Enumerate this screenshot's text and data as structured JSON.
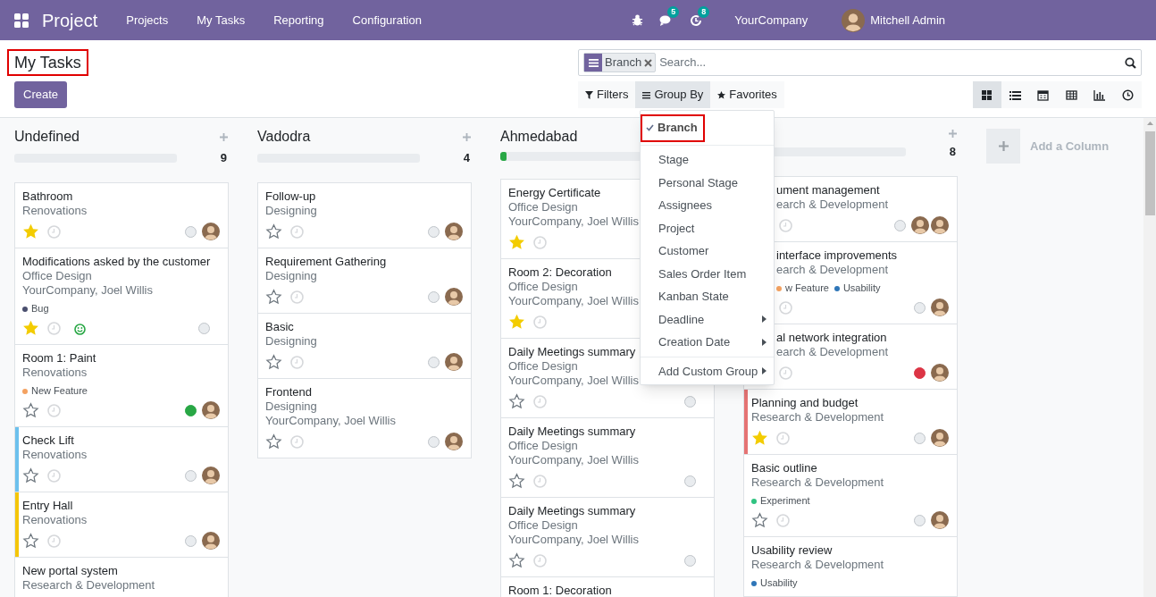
{
  "navbar": {
    "app_title": "Project",
    "menu": [
      "Projects",
      "My Tasks",
      "Reporting",
      "Configuration"
    ],
    "systray": [
      {
        "kind": "bug"
      },
      {
        "kind": "chat",
        "badge": "5"
      },
      {
        "kind": "activity",
        "badge": "8"
      }
    ],
    "company": "YourCompany",
    "user": "Mitchell Admin"
  },
  "breadcrumb": "My Tasks",
  "create_button": "Create",
  "search": {
    "facets": [
      {
        "label": "Branch"
      }
    ],
    "placeholder": "Search..."
  },
  "search_buttons": [
    {
      "kind": "filter",
      "label": "Filters",
      "selected": false
    },
    {
      "kind": "group",
      "label": "Group By",
      "selected": true
    },
    {
      "kind": "favorite",
      "label": "Favorites",
      "selected": false
    }
  ],
  "views": [
    {
      "kind": "kanban",
      "selected": true
    },
    {
      "kind": "list",
      "selected": false
    },
    {
      "kind": "calendar",
      "selected": false
    },
    {
      "kind": "pivot",
      "selected": false
    },
    {
      "kind": "graph",
      "selected": false
    },
    {
      "kind": "activity",
      "selected": false
    }
  ],
  "group_by_menu": {
    "sections": [
      [
        {
          "label": "Branch",
          "checked": true,
          "submenu": false
        }
      ],
      [
        {
          "label": "Stage",
          "checked": false,
          "submenu": false
        },
        {
          "label": "Personal Stage",
          "checked": false,
          "submenu": false
        },
        {
          "label": "Assignees",
          "checked": false,
          "submenu": false
        },
        {
          "label": "Project",
          "checked": false,
          "submenu": false
        },
        {
          "label": "Customer",
          "checked": false,
          "submenu": false
        },
        {
          "label": "Sales Order Item",
          "checked": false,
          "submenu": false
        },
        {
          "label": "Kanban State",
          "checked": false,
          "submenu": false
        },
        {
          "label": "Deadline",
          "checked": false,
          "submenu": true
        },
        {
          "label": "Creation Date",
          "checked": false,
          "submenu": true
        }
      ],
      [
        {
          "label": "Add Custom Group",
          "checked": false,
          "submenu": true
        }
      ]
    ]
  },
  "columns": [
    {
      "title": "Undefined",
      "count": "9",
      "level": 0,
      "cards": [
        {
          "title": "Bathroom",
          "lines": [
            "Renovations"
          ],
          "starred": true,
          "rated": false,
          "done": false,
          "blocked": false,
          "avatars": [
            {
              "kind": "person"
            }
          ]
        },
        {
          "title": "Modifications asked by the customer",
          "lines": [
            "Office Design",
            "YourCompany, Joel Willis"
          ],
          "tags": [
            {
              "label": "Bug",
              "color": "#4a4f6e"
            }
          ],
          "starred": true,
          "rated": true,
          "done": false,
          "blocked": false
        },
        {
          "title": "Room 1: Paint",
          "lines": [
            "Renovations"
          ],
          "tags": [
            {
              "label": "New Feature",
              "color": "#f4a261"
            }
          ],
          "starred": false,
          "rated": false,
          "done": true,
          "blocked": false,
          "avatars": [
            {
              "kind": "person"
            }
          ]
        },
        {
          "title": "Check Lift",
          "lines": [
            "Renovations"
          ],
          "color": "#6cc1ed",
          "starred": false,
          "rated": false,
          "done": false,
          "blocked": false,
          "avatars": [
            {
              "kind": "person"
            }
          ]
        },
        {
          "title": "Entry Hall",
          "lines": [
            "Renovations"
          ],
          "color": "#f4c609",
          "starred": false,
          "rated": false,
          "done": false,
          "blocked": false,
          "avatars": [
            {
              "kind": "person"
            }
          ]
        },
        {
          "title": "New portal system",
          "lines": [
            "Research & Development"
          ]
        }
      ]
    },
    {
      "title": "Vadodra",
      "count": "4",
      "level": 0,
      "cards": [
        {
          "title": "Follow-up",
          "lines": [
            "Designing"
          ],
          "starred": false,
          "rated": false,
          "done": false,
          "blocked": false,
          "avatars": [
            {
              "kind": "person"
            }
          ]
        },
        {
          "title": "Requirement Gathering",
          "lines": [
            "Designing"
          ],
          "starred": false,
          "rated": false,
          "done": false,
          "blocked": false,
          "avatars": [
            {
              "kind": "person"
            }
          ]
        },
        {
          "title": "Basic",
          "lines": [
            "Designing"
          ],
          "starred": false,
          "rated": false,
          "done": false,
          "blocked": false,
          "avatars": [
            {
              "kind": "person"
            }
          ]
        },
        {
          "title": "Frontend",
          "lines": [
            "Designing",
            "YourCompany, Joel Willis"
          ],
          "starred": false,
          "rated": false,
          "done": false,
          "blocked": false,
          "avatars": [
            {
              "kind": "person"
            }
          ]
        }
      ]
    },
    {
      "title": "Ahmedabad",
      "level": 0.04,
      "cards": [
        {
          "title": "Energy Certificate",
          "lines": [
            "Office Design",
            "YourCompany, Joel Willis"
          ],
          "starred": true,
          "rated": false
        },
        {
          "title": "Room 2: Decoration",
          "lines": [
            "Office Design",
            "YourCompany, Joel Willis"
          ],
          "starred": true,
          "rated": false
        },
        {
          "title": "Daily Meetings summary",
          "lines": [
            "Office Design",
            "YourCompany, Joel Willis"
          ],
          "starred": false,
          "rated": false,
          "done": false,
          "blocked": false
        },
        {
          "title": "Daily Meetings summary",
          "lines": [
            "Office Design",
            "YourCompany, Joel Willis"
          ],
          "starred": false,
          "rated": false,
          "done": false,
          "blocked": false
        },
        {
          "title": "Daily Meetings summary",
          "lines": [
            "Office Design",
            "YourCompany, Joel Willis"
          ],
          "starred": false,
          "rated": false,
          "done": false,
          "blocked": false
        },
        {
          "title": "Room 1: Decoration"
        }
      ]
    },
    {
      "count": "8",
      "level": 0,
      "cards": [
        {
          "title": "ument management",
          "lines": [
            "earch & Development"
          ],
          "covered": true,
          "rated": false,
          "done": false,
          "blocked": false,
          "avatars": [
            {
              "kind": "person"
            },
            {
              "kind": "person"
            }
          ]
        },
        {
          "title": "interface improvements",
          "lines": [
            "earch & Development"
          ],
          "tags": [
            {
              "label": "w Feature",
              "color": "#f4a261"
            },
            {
              "label": "Usability",
              "color": "#2f76b8"
            }
          ],
          "covered": true,
          "rated": false,
          "done": false,
          "blocked": false,
          "avatars": [
            {
              "kind": "person"
            }
          ]
        },
        {
          "title": "al network integration",
          "lines": [
            "earch & Development"
          ],
          "covered": true,
          "rated": false,
          "done": false,
          "blocked": true,
          "avatars": [
            {
              "kind": "person"
            }
          ]
        },
        {
          "title": "Planning and budget",
          "lines": [
            "Research & Development"
          ],
          "color": "#e57373",
          "covered": false,
          "starred": true,
          "rated": false,
          "done": false,
          "blocked": false,
          "avatars": [
            {
              "kind": "person"
            }
          ]
        },
        {
          "title": "Basic outline",
          "lines": [
            "Research & Development"
          ],
          "tags": [
            {
              "label": "Experiment",
              "color": "#30c381"
            }
          ],
          "covered": false,
          "starred": false,
          "rated": false,
          "done": false,
          "blocked": false,
          "avatars": [
            {
              "kind": "person"
            }
          ]
        },
        {
          "title": "Usability review",
          "lines": [
            "Research & Development"
          ],
          "tags": [
            {
              "label": "Usability",
              "color": "#2f76b8"
            }
          ],
          "covered": false
        }
      ]
    }
  ],
  "add_column": "Add a Column"
}
